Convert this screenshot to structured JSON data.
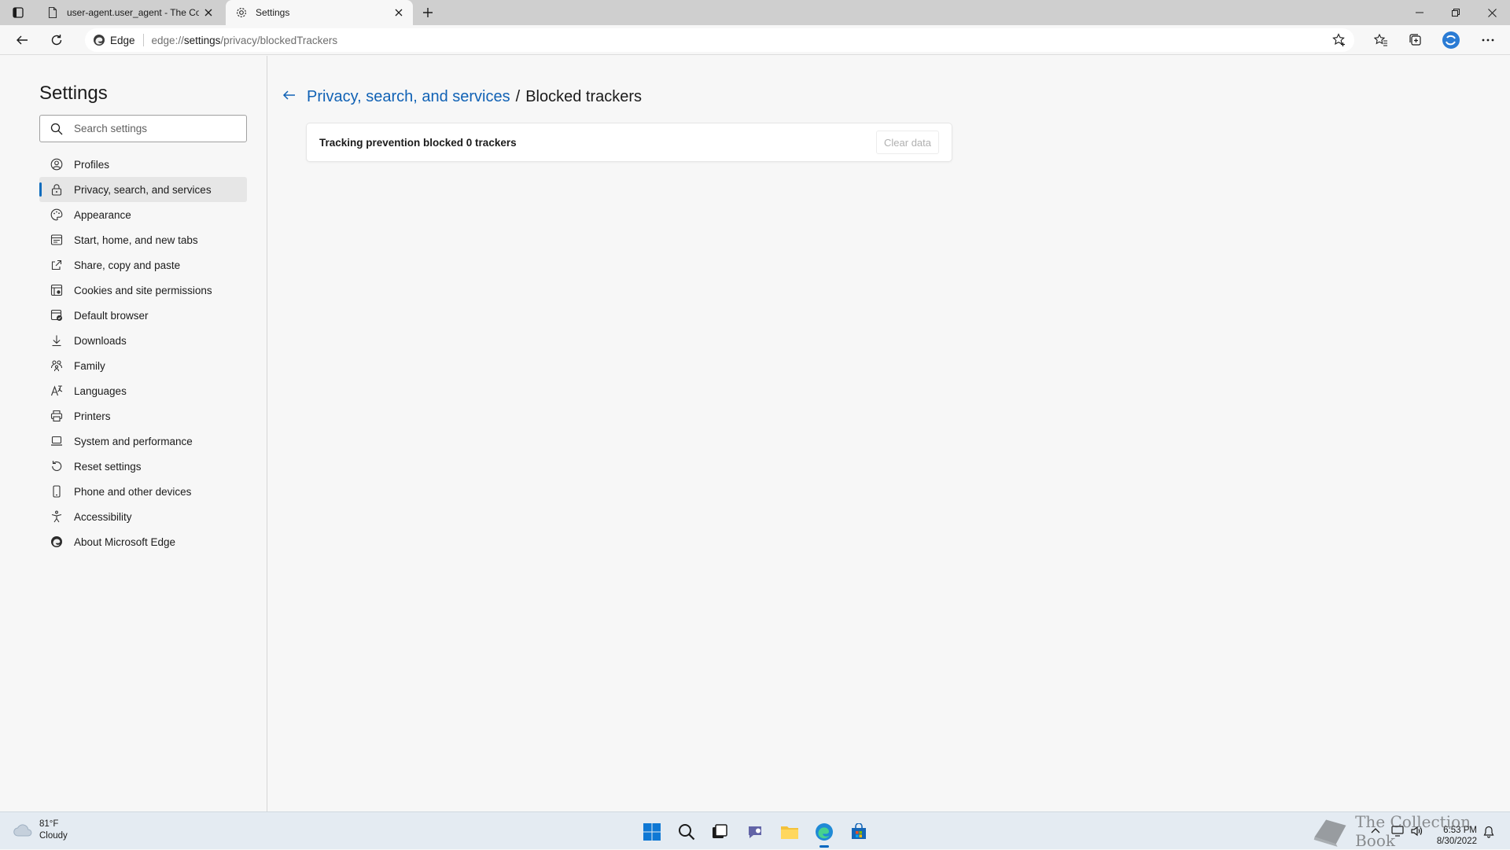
{
  "browser": {
    "tabs": [
      {
        "title": "user-agent.user_agent - The Coll",
        "active": false,
        "icon": "page-icon"
      },
      {
        "title": "Settings",
        "active": true,
        "icon": "gear-icon"
      }
    ],
    "address_bar": {
      "site_label": "Edge",
      "url_scheme": "edge://",
      "url_host": "settings",
      "url_path": "/privacy/blockedTrackers"
    }
  },
  "sidebar": {
    "title": "Settings",
    "search_placeholder": "Search settings",
    "items": [
      {
        "label": "Profiles",
        "icon": "profile-icon"
      },
      {
        "label": "Privacy, search, and services",
        "icon": "lock-icon",
        "active": true
      },
      {
        "label": "Appearance",
        "icon": "appearance-icon"
      },
      {
        "label": "Start, home, and new tabs",
        "icon": "home-tabs-icon"
      },
      {
        "label": "Share, copy and paste",
        "icon": "share-icon"
      },
      {
        "label": "Cookies and site permissions",
        "icon": "cookies-icon"
      },
      {
        "label": "Default browser",
        "icon": "default-browser-icon"
      },
      {
        "label": "Downloads",
        "icon": "download-icon"
      },
      {
        "label": "Family",
        "icon": "family-icon"
      },
      {
        "label": "Languages",
        "icon": "languages-icon"
      },
      {
        "label": "Printers",
        "icon": "printer-icon"
      },
      {
        "label": "System and performance",
        "icon": "system-icon"
      },
      {
        "label": "Reset settings",
        "icon": "reset-icon"
      },
      {
        "label": "Phone and other devices",
        "icon": "phone-icon"
      },
      {
        "label": "Accessibility",
        "icon": "accessibility-icon"
      },
      {
        "label": "About Microsoft Edge",
        "icon": "edge-icon"
      }
    ]
  },
  "main": {
    "breadcrumb_parent": "Privacy, search, and services",
    "breadcrumb_separator": "/",
    "breadcrumb_current": "Blocked trackers",
    "card_text": "Tracking prevention blocked 0 trackers",
    "clear_button": "Clear data"
  },
  "taskbar": {
    "weather_temp": "81°F",
    "weather_desc": "Cloudy",
    "clock_time": "6:53 PM",
    "clock_date": "8/30/2022",
    "watermark": "The Collection Book",
    "accent_color": "#0067c0"
  }
}
